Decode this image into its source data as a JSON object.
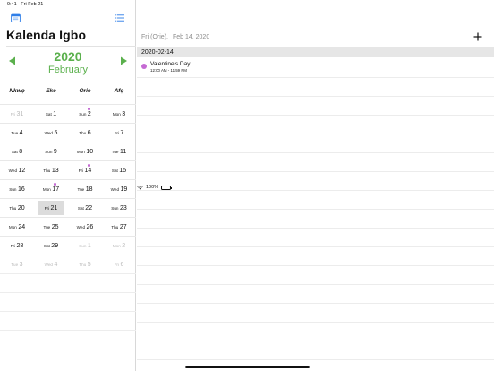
{
  "status_bar": {
    "time": "9:41",
    "date": "Fri Feb 21",
    "battery": "100%"
  },
  "app": {
    "title": "Kalenda Igbo"
  },
  "nav": {
    "year": "2020",
    "month": "February"
  },
  "market_days": [
    "Nkwọ",
    "Eke",
    "Orie",
    "Afọ"
  ],
  "calendar_rows": [
    [
      {
        "wd": "Fri",
        "dn": "31",
        "dim": true
      },
      {
        "wd": "Sat",
        "dn": "1"
      },
      {
        "wd": "Sun",
        "dn": "2",
        "dot": true
      },
      {
        "wd": "Mon",
        "dn": "3"
      }
    ],
    [
      {
        "wd": "Tue",
        "dn": "4"
      },
      {
        "wd": "Wed",
        "dn": "5"
      },
      {
        "wd": "Thu",
        "dn": "6"
      },
      {
        "wd": "Fri",
        "dn": "7"
      }
    ],
    [
      {
        "wd": "Sat",
        "dn": "8"
      },
      {
        "wd": "Sun",
        "dn": "9"
      },
      {
        "wd": "Mon",
        "dn": "10"
      },
      {
        "wd": "Tue",
        "dn": "11"
      }
    ],
    [
      {
        "wd": "Wed",
        "dn": "12"
      },
      {
        "wd": "Thu",
        "dn": "13"
      },
      {
        "wd": "Fri",
        "dn": "14",
        "dot": true
      },
      {
        "wd": "Sat",
        "dn": "15"
      }
    ],
    [
      {
        "wd": "Sun",
        "dn": "16"
      },
      {
        "wd": "Mon",
        "dn": "17",
        "dot": true
      },
      {
        "wd": "Tue",
        "dn": "18"
      },
      {
        "wd": "Wed",
        "dn": "19"
      }
    ],
    [
      {
        "wd": "Thu",
        "dn": "20"
      },
      {
        "wd": "Fri",
        "dn": "21",
        "selected": true
      },
      {
        "wd": "Sat",
        "dn": "22"
      },
      {
        "wd": "Sun",
        "dn": "23"
      }
    ],
    [
      {
        "wd": "Mon",
        "dn": "24"
      },
      {
        "wd": "Tue",
        "dn": "25"
      },
      {
        "wd": "Wed",
        "dn": "26"
      },
      {
        "wd": "Thu",
        "dn": "27"
      }
    ],
    [
      {
        "wd": "Fri",
        "dn": "28"
      },
      {
        "wd": "Sat",
        "dn": "29"
      },
      {
        "wd": "Sun",
        "dn": "1",
        "dim": true
      },
      {
        "wd": "Mon",
        "dn": "2",
        "dim": true
      }
    ],
    [
      {
        "wd": "Tue",
        "dn": "3",
        "dim": true
      },
      {
        "wd": "Wed",
        "dn": "4",
        "dim": true
      },
      {
        "wd": "Thu",
        "dn": "5",
        "dim": true
      },
      {
        "wd": "Fri",
        "dn": "6",
        "dim": true
      }
    ]
  ],
  "detail": {
    "market_day": "Fri (Orie),",
    "date": "Feb 14, 2020",
    "section_date": "2020-02-14",
    "event": {
      "title": "Valentine's Day",
      "time": "12:00 AM  -  11:59 PM",
      "color": "#c56ad3"
    }
  },
  "colors": {
    "accent": "#2f7ee8",
    "green": "#5bb04d",
    "event_dot": "#c56ad3"
  }
}
